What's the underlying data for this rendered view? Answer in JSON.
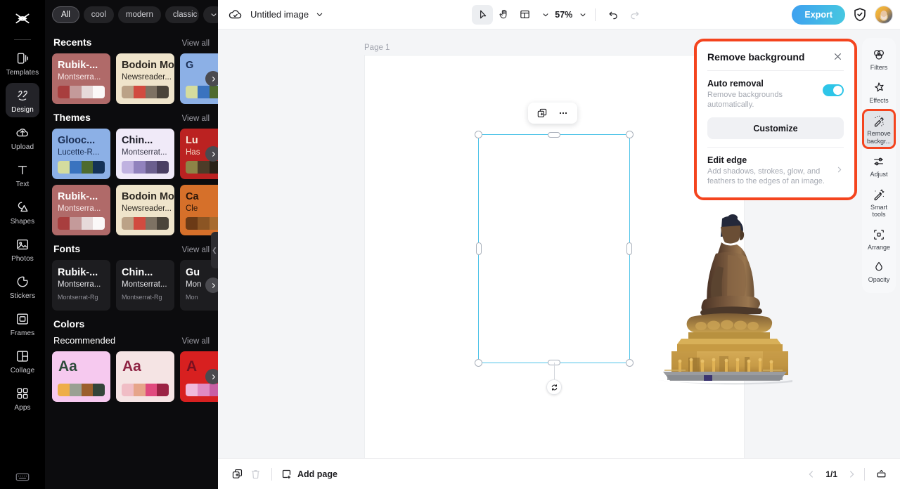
{
  "rail": {
    "logo_icon": "capcut-logo-icon",
    "items": [
      {
        "label": "Templates",
        "icon": "templates-icon",
        "active": false
      },
      {
        "label": "Design",
        "icon": "design-icon",
        "active": true
      },
      {
        "label": "Upload",
        "icon": "upload-cloud-icon",
        "active": false
      },
      {
        "label": "Text",
        "icon": "text-icon",
        "active": false
      },
      {
        "label": "Shapes",
        "icon": "shapes-icon",
        "active": false
      },
      {
        "label": "Photos",
        "icon": "photos-icon",
        "active": false
      },
      {
        "label": "Stickers",
        "icon": "stickers-icon",
        "active": false
      },
      {
        "label": "Frames",
        "icon": "frames-icon",
        "active": false
      },
      {
        "label": "Collage",
        "icon": "collage-icon",
        "active": false
      },
      {
        "label": "Apps",
        "icon": "apps-grid-icon",
        "active": false
      }
    ],
    "bottom_icon": "keyboard-icon"
  },
  "panel": {
    "chips": [
      "All",
      "cool",
      "modern",
      "classic"
    ],
    "chips_more_icon": "chevron-down-icon",
    "view_all": "View all",
    "next_arrow_icon": "chevron-right-icon",
    "collapse_icon": "chevron-left-icon",
    "sections": [
      {
        "title": "Recents",
        "cards": [
          {
            "t1": "Rubik-...",
            "t2": "Montserra...",
            "bg": "#b06a69",
            "t1c": "#ffffff",
            "t2c": "#f6e6e6",
            "swatches": [
              "#a83e3e",
              "#c49a9a",
              "#e6dada",
              "#fbf8f8"
            ]
          },
          {
            "t1": "Bodoin Mo...",
            "t2": "Newsreader...",
            "bg": "#efe4cb",
            "t1c": "#2b2620",
            "t2c": "#2b2620",
            "swatches": [
              "#bba287",
              "#d14b40",
              "#7e7263",
              "#4b443a"
            ]
          },
          {
            "t1": "G",
            "t2": "",
            "bg": "#8cb0e6",
            "t1c": "#1b2f55",
            "t2c": "#1b2f55",
            "swatches": [
              "#d4dc9e",
              "#3a73bf",
              "#4e6b2e",
              "#143257"
            ]
          }
        ]
      },
      {
        "title": "Themes",
        "cards": [
          {
            "t1": "Glooc...",
            "t2": "Lucette-R...",
            "bg": "#8cb0e6",
            "t1c": "#1b2f55",
            "t2c": "#1b2f55",
            "swatches": [
              "#d4dc9e",
              "#3a73bf",
              "#4e6b2e",
              "#143257"
            ]
          },
          {
            "t1": "Chin...",
            "t2": "Montserrat...",
            "bg": "#f0eaf8",
            "t1c": "#1a1a24",
            "t2c": "#3a3a4a",
            "swatches": [
              "#c0b2e0",
              "#9182bd",
              "#6b5f8e",
              "#4a3f63"
            ]
          },
          {
            "t1": "Lu",
            "t2": "Has",
            "bg": "#bb2221",
            "t1c": "#f7e6d6",
            "t2c": "#f2d9c6",
            "swatches": [
              "#8d8447",
              "#4c3c28",
              "#2b2218",
              "#1a1410"
            ]
          },
          {
            "t1": "Rubik-...",
            "t2": "Montserra...",
            "bg": "#b06a69",
            "t1c": "#ffffff",
            "t2c": "#f6e6e6",
            "swatches": [
              "#a83e3e",
              "#c49a9a",
              "#e6dada",
              "#fbf8f8"
            ]
          },
          {
            "t1": "Bodoin Mo...",
            "t2": "Newsreader...",
            "bg": "#efe4cb",
            "t1c": "#2b2620",
            "t2c": "#2b2620",
            "swatches": [
              "#bba287",
              "#d14b40",
              "#7e7263",
              "#4b443a"
            ]
          },
          {
            "t1": "Ca",
            "t2": "Cle",
            "bg": "#d6702a",
            "t1c": "#2a1508",
            "t2c": "#2a1508",
            "swatches": [
              "#6b3a16",
              "#8b5524",
              "#a86b2e",
              "#c58b44"
            ]
          }
        ]
      },
      {
        "title": "Fonts",
        "fonts": [
          {
            "f1": "Rubik-...",
            "f2": "Montserra...",
            "f3": "Montserrat-Rg"
          },
          {
            "f1": "Chin...",
            "f2": "Montserrat...",
            "f3": "Montserrat-Rg"
          },
          {
            "f1": "Gu",
            "f2": "Mon",
            "f3": "Mon"
          }
        ]
      }
    ],
    "colors": {
      "title": "Colors",
      "sub": "Recommended",
      "cards": [
        {
          "aa": "Aa",
          "bg": "#f6c9ef",
          "fg": "#2d4a3a",
          "swatches": [
            "#eeae4a",
            "#9aa093",
            "#9b5f2c",
            "#33453a"
          ]
        },
        {
          "aa": "Aa",
          "bg": "#f5e4e4",
          "fg": "#8e2343",
          "swatches": [
            "#f0bdc5",
            "#e6a58a",
            "#e04a7e",
            "#9b2244"
          ]
        },
        {
          "aa": "A",
          "bg": "#d82020",
          "fg": "#7a1020",
          "swatches": [
            "#f0b9dc",
            "#e08ac2",
            "#c85fa4",
            "#a33a82"
          ]
        }
      ]
    }
  },
  "topbar": {
    "cloud_icon": "cloud-sync-icon",
    "doc_title": "Untitled image",
    "title_caret_icon": "chevron-down-icon",
    "select_tool_icon": "cursor-select-icon",
    "hand_tool_icon": "hand-pan-icon",
    "layout_tool_icon": "page-layout-icon",
    "layout_caret_icon": "chevron-down-icon",
    "zoom_level": "57%",
    "zoom_caret_icon": "chevron-down-icon",
    "undo_icon": "undo-icon",
    "redo_icon": "redo-icon",
    "export_label": "Export",
    "shield_icon": "shield-check-icon",
    "avatar_name": "user-avatar"
  },
  "canvas": {
    "page_label": "Page 1",
    "image_alt": "buddha-statue",
    "context_duplicate_icon": "duplicate-icon",
    "context_more_icon": "more-horizontal-icon",
    "rotate_icon": "rotate-handle-icon"
  },
  "remove_bg": {
    "title": "Remove background",
    "close_icon": "close-icon",
    "auto_removal_title": "Auto removal",
    "auto_removal_desc": "Remove backgrounds automatically.",
    "toggle_on": true,
    "toggle_color": "#2ec5e8",
    "customize_label": "Customize",
    "edit_edge_title": "Edit edge",
    "edit_edge_desc": "Add shadows, strokes, glow, and feathers to the edges of an image.",
    "edit_edge_chevron_icon": "chevron-right-icon",
    "highlight_color": "#f4441e"
  },
  "right_toolbar": {
    "items": [
      {
        "label": "Filters",
        "icon": "filters-icon",
        "highlighted": false
      },
      {
        "label": "Effects",
        "icon": "effects-star-icon",
        "highlighted": false
      },
      {
        "label": "Remove backgr...",
        "icon": "remove-background-icon",
        "highlighted": true
      },
      {
        "label": "Adjust",
        "icon": "adjust-sliders-icon",
        "highlighted": false
      },
      {
        "label": "Smart tools",
        "icon": "smart-tools-wand-icon",
        "highlighted": false
      },
      {
        "label": "Arrange",
        "icon": "arrange-icon",
        "highlighted": false
      },
      {
        "label": "Opacity",
        "icon": "opacity-drop-icon",
        "highlighted": false
      }
    ]
  },
  "bottombar": {
    "duplicate_page_icon": "duplicate-page-icon",
    "delete_page_icon": "trash-icon",
    "add_page_icon": "add-page-icon",
    "add_page_label": "Add page",
    "prev_icon": "chevron-left-icon",
    "page_indicator": "1/1",
    "next_icon": "chevron-right-icon",
    "present_icon": "present-icon"
  }
}
